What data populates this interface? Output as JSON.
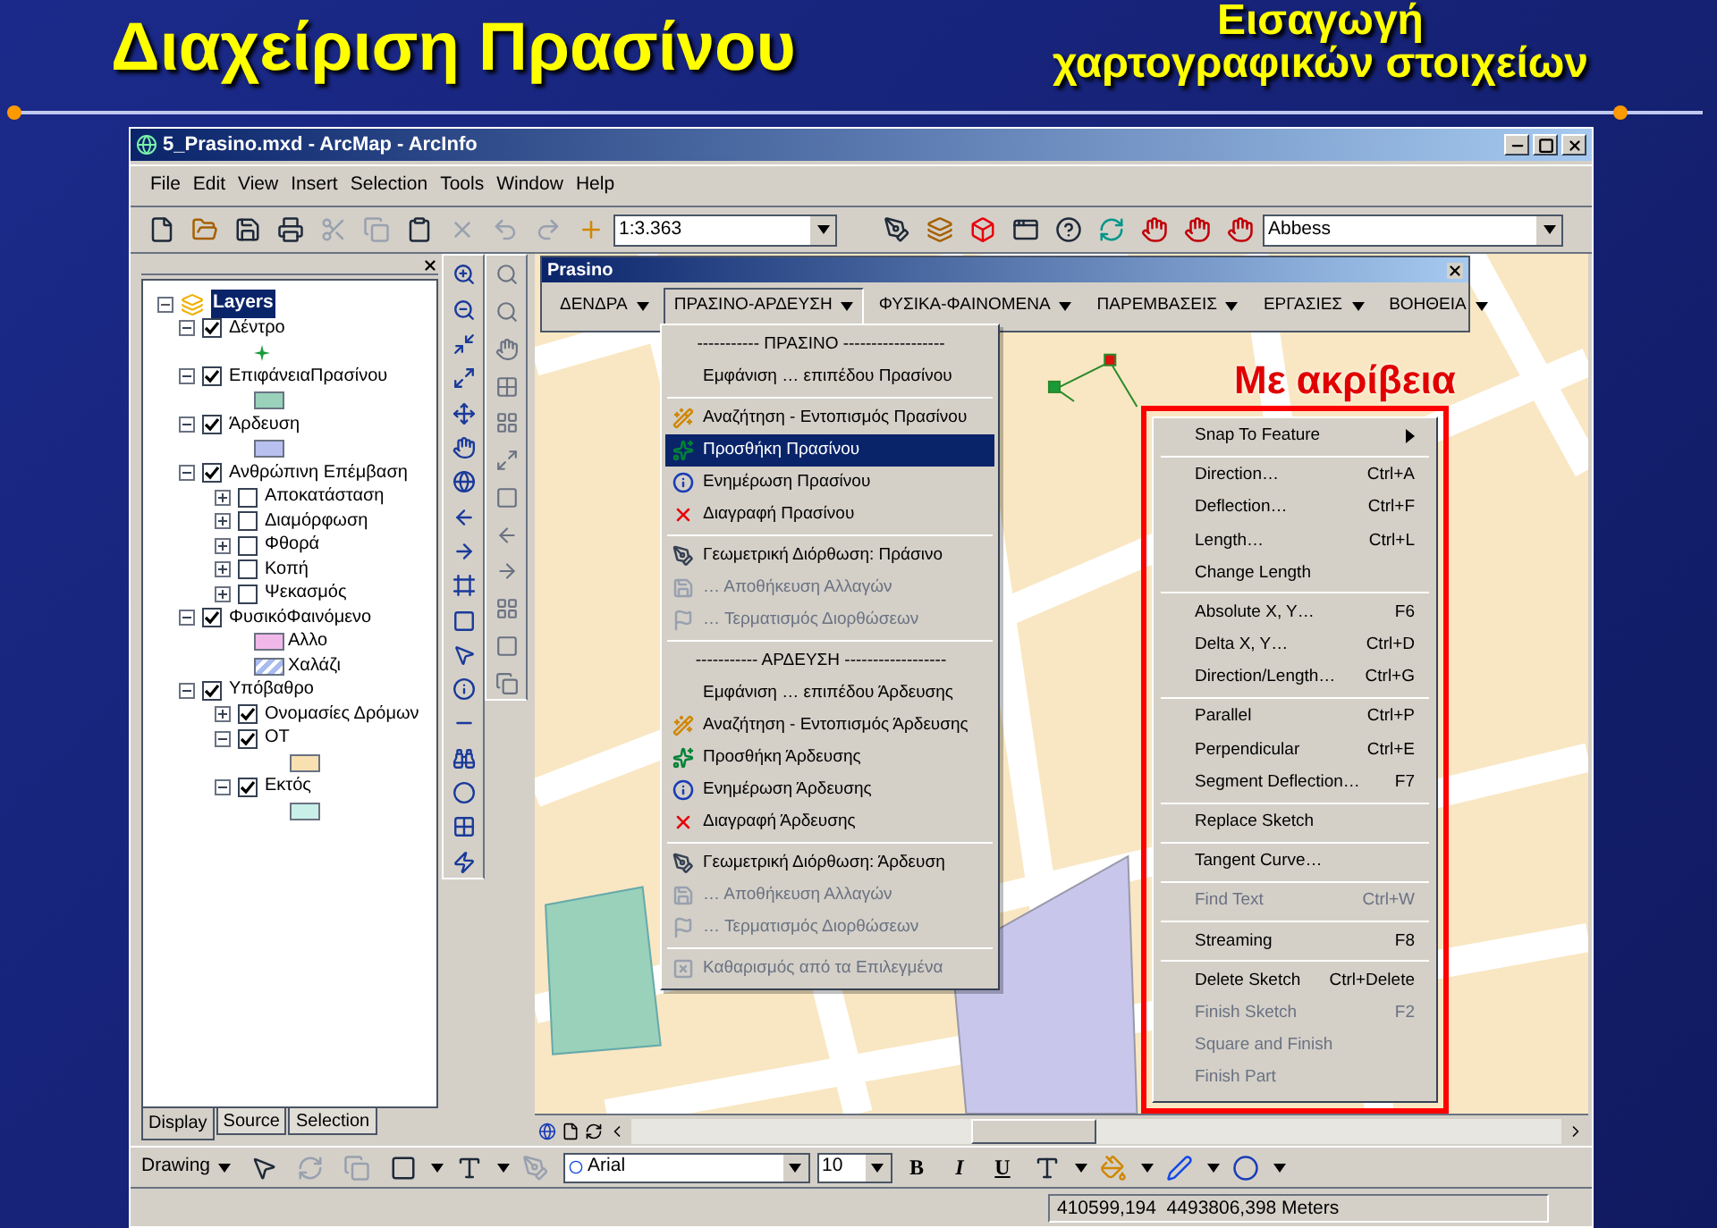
{
  "slide": {
    "title": "Διαχείριση Πρασίνου",
    "subtitle_lines": [
      "Εισαγωγή",
      "χαρτογραφικών στοιχείων"
    ]
  },
  "window": {
    "title": "5_Prasino.mxd - ArcMap - ArcInfo"
  },
  "menu": [
    "File",
    "Edit",
    "View",
    "Insert",
    "Selection",
    "Tools",
    "Window",
    "Help"
  ],
  "toolbar": {
    "scale": "1:3.363",
    "layer": "Abbess"
  },
  "toc": {
    "root": "Layers",
    "layers": [
      {
        "label": "Δέντρο",
        "checked": true,
        "expanded": true,
        "legend": [
          {
            "kind": "marker",
            "color": "#1a9a3a"
          }
        ]
      },
      {
        "label": "ΕπιφάνειαΠρασίνου",
        "checked": true,
        "expanded": true,
        "legend": [
          {
            "kind": "fill",
            "color": "#99d1bb"
          }
        ]
      },
      {
        "label": "Άρδευση",
        "checked": true,
        "expanded": true,
        "legend": [
          {
            "kind": "fill",
            "color": "#b8c0f0"
          }
        ]
      },
      {
        "label": "Ανθρώπινη Επέμβαση",
        "checked": true,
        "expanded": true,
        "children": [
          {
            "label": "Αποκατάσταση",
            "checked": false,
            "expanded": false
          },
          {
            "label": "Διαμόρφωση",
            "checked": false,
            "expanded": false
          },
          {
            "label": "Φθορά",
            "checked": false,
            "expanded": false
          },
          {
            "label": "Κοπή",
            "checked": false,
            "expanded": false
          },
          {
            "label": "Ψεκασμός",
            "checked": false,
            "expanded": false
          }
        ]
      },
      {
        "label": "ΦυσικόΦαινόμενο",
        "checked": true,
        "expanded": true,
        "legend": [
          {
            "kind": "fill",
            "color": "#f0b8e8",
            "label": "Αλλο"
          },
          {
            "kind": "hatch",
            "color": "#a8bcf0",
            "label": "Χαλάζι"
          }
        ]
      },
      {
        "label": "Υπόβαθρο",
        "checked": true,
        "expanded": true,
        "children": [
          {
            "label": "Ονομασίες Δρόμων",
            "checked": true,
            "expanded": false
          },
          {
            "label": "ΟΤ",
            "checked": true,
            "expanded": true,
            "legend": [
              {
                "kind": "fill",
                "color": "#f8e0b0"
              }
            ]
          },
          {
            "label": "Εκτός",
            "checked": true,
            "expanded": true,
            "legend": [
              {
                "kind": "fill",
                "color": "#c8f0e8"
              }
            ]
          }
        ]
      }
    ]
  },
  "toc_tabs": [
    {
      "label": "Display",
      "selected": true
    },
    {
      "label": "Source",
      "selected": false
    },
    {
      "label": "Selection",
      "selected": false
    }
  ],
  "prasino": {
    "title": "Prasino",
    "menus": [
      {
        "label": "ΔΕΝΔΡΑ",
        "selected": false
      },
      {
        "label": "ΠΡΑΣΙΝΟ-ΑΡΔΕΥΣΗ",
        "selected": true
      },
      {
        "label": "ΦΥΣΙΚΑ-ΦΑΙΝΟΜΕΝΑ",
        "selected": false
      },
      {
        "label": "ΠΑΡΕΜΒΑΣΕΙΣ",
        "selected": false
      },
      {
        "label": "ΕΡΓΑΣΙΕΣ",
        "selected": false
      },
      {
        "label": "ΒΟΗΘΕΙΑ",
        "selected": false
      }
    ]
  },
  "dropdown": [
    {
      "kind": "header",
      "label": "----------- ΠΡΑΣΙΝΟ ------------------",
      "disabled": false,
      "selected": false
    },
    {
      "kind": "plain",
      "label": "Εμφάνιση … επιπέδου Πρασίνου",
      "disabled": false,
      "selected": false
    },
    {
      "kind": "separator"
    },
    {
      "kind": "search",
      "label": "Αναζήτηση - Εντοπισμός Πρασίνου",
      "disabled": false,
      "selected": false
    },
    {
      "kind": "add",
      "label": "Προσθήκη Πρασίνου",
      "disabled": false,
      "selected": true
    },
    {
      "kind": "update",
      "label": "Ενημέρωση Πρασίνου",
      "disabled": false,
      "selected": false
    },
    {
      "kind": "delete",
      "label": "Διαγραφή Πρασίνου",
      "disabled": false,
      "selected": false
    },
    {
      "kind": "separator"
    },
    {
      "kind": "edit",
      "label": "Γεωμετρική Διόρθωση: Πράσινο",
      "disabled": false,
      "selected": false
    },
    {
      "kind": "save",
      "label": "… Αποθήκευση Αλλαγών",
      "disabled": true,
      "selected": false
    },
    {
      "kind": "finish",
      "label": "… Τερματισμός Διορθώσεων",
      "disabled": true,
      "selected": false
    },
    {
      "kind": "separator"
    },
    {
      "kind": "header",
      "label": "----------- ΑΡΔΕΥΣΗ ------------------",
      "disabled": false,
      "selected": false
    },
    {
      "kind": "plain",
      "label": "Εμφάνιση … επιπέδου Άρδευσης",
      "disabled": false,
      "selected": false
    },
    {
      "kind": "search",
      "label": "Αναζήτηση - Εντοπισμός Άρδευσης",
      "disabled": false,
      "selected": false
    },
    {
      "kind": "add",
      "label": "Προσθήκη Άρδευσης",
      "disabled": false,
      "selected": false
    },
    {
      "kind": "update",
      "label": "Ενημέρωση Άρδευσης",
      "disabled": false,
      "selected": false
    },
    {
      "kind": "delete",
      "label": "Διαγραφή Άρδευσης",
      "disabled": false,
      "selected": false
    },
    {
      "kind": "separator"
    },
    {
      "kind": "edit",
      "label": "Γεωμετρική Διόρθωση: Άρδευση",
      "disabled": false,
      "selected": false
    },
    {
      "kind": "save",
      "label": "… Αποθήκευση Αλλαγών",
      "disabled": true,
      "selected": false
    },
    {
      "kind": "finish",
      "label": "… Τερματισμός Διορθώσεων",
      "disabled": true,
      "selected": false
    },
    {
      "kind": "separator"
    },
    {
      "kind": "clear",
      "label": "Καθαρισμός από τα Επιλεγμένα",
      "disabled": true,
      "selected": false
    }
  ],
  "annotation": "Με ακρίβεια",
  "context_menu": [
    {
      "kind": "submenu",
      "label": "Snap To Feature",
      "disabled": false
    },
    {
      "kind": "separator"
    },
    {
      "kind": "item",
      "label": "Direction…",
      "shortcut": "Ctrl+A",
      "disabled": false
    },
    {
      "kind": "item",
      "label": "Deflection…",
      "shortcut": "Ctrl+F",
      "disabled": false
    },
    {
      "kind": "item",
      "label": "Length…",
      "shortcut": "Ctrl+L",
      "disabled": false
    },
    {
      "kind": "item",
      "label": "Change Length",
      "disabled": false
    },
    {
      "kind": "separator"
    },
    {
      "kind": "item",
      "label": "Absolute X, Y…",
      "shortcut": "F6",
      "disabled": false
    },
    {
      "kind": "item",
      "label": "Delta X, Y…",
      "shortcut": "Ctrl+D",
      "disabled": false
    },
    {
      "kind": "item",
      "label": "Direction/Length…",
      "shortcut": "Ctrl+G",
      "disabled": false
    },
    {
      "kind": "separator"
    },
    {
      "kind": "item",
      "label": "Parallel",
      "shortcut": "Ctrl+P",
      "disabled": false
    },
    {
      "kind": "item",
      "label": "Perpendicular",
      "shortcut": "Ctrl+E",
      "disabled": false
    },
    {
      "kind": "item",
      "label": "Segment Deflection…",
      "shortcut": "F7",
      "disabled": false
    },
    {
      "kind": "separator"
    },
    {
      "kind": "item",
      "label": "Replace Sketch",
      "disabled": false
    },
    {
      "kind": "separator"
    },
    {
      "kind": "item",
      "label": "Tangent Curve…",
      "disabled": false
    },
    {
      "kind": "separator"
    },
    {
      "kind": "item",
      "label": "Find Text",
      "shortcut": "Ctrl+W",
      "disabled": true
    },
    {
      "kind": "separator"
    },
    {
      "kind": "item",
      "label": "Streaming",
      "shortcut": "F8",
      "disabled": false
    },
    {
      "kind": "separator"
    },
    {
      "kind": "item",
      "label": "Delete Sketch",
      "shortcut": "Ctrl+Delete",
      "disabled": false
    },
    {
      "kind": "item",
      "label": "Finish Sketch",
      "shortcut": "F2",
      "disabled": true
    },
    {
      "kind": "item",
      "label": "Square and Finish",
      "disabled": true
    },
    {
      "kind": "item",
      "label": "Finish Part",
      "disabled": true
    }
  ],
  "drawing_toolbar": {
    "menu": "Drawing",
    "font": "Arial",
    "size": "10",
    "format": [
      "B",
      "I",
      "U"
    ]
  },
  "status": "410599,194  4493806,398 Meters"
}
